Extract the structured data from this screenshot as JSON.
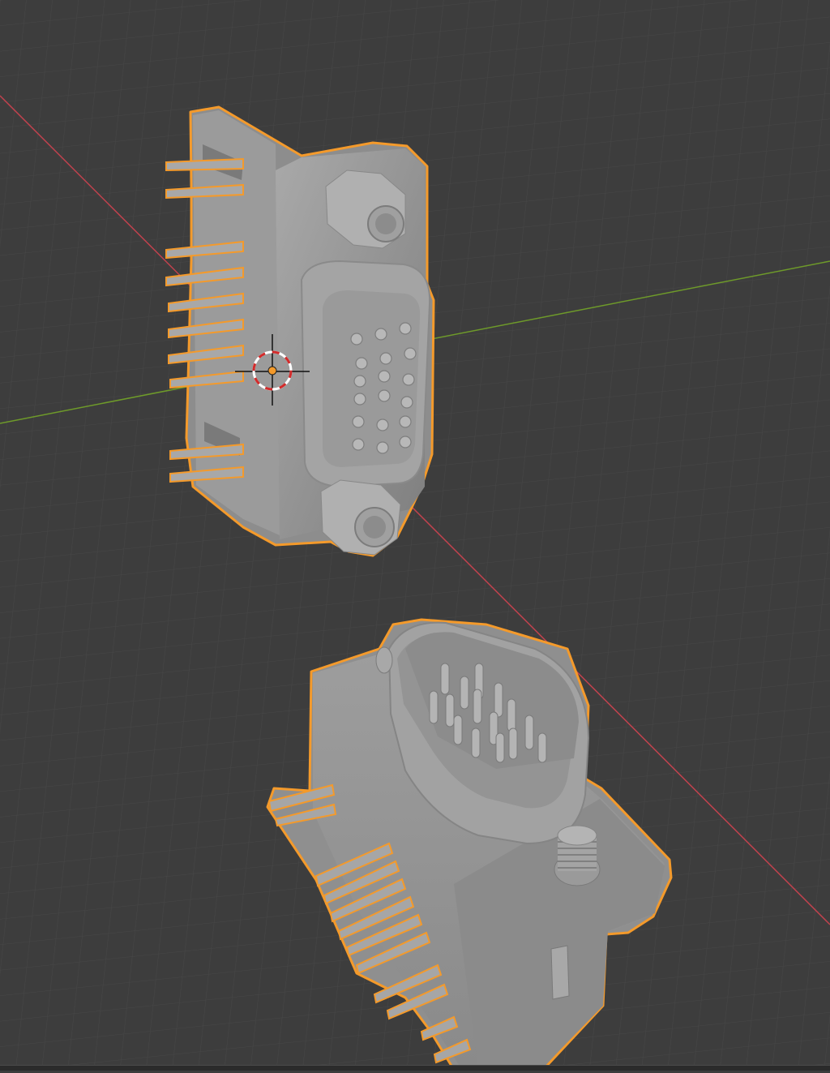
{
  "viewport": {
    "mode": "solid",
    "background": "#3d3d3d",
    "grid_minor_color": "#474747",
    "grid_major_color": "#4f4f4f",
    "x_axis_color": "#c2424e",
    "y_axis_color": "#6e9a2a",
    "selection_outline_color": "#f49a2b",
    "mesh_color": "#9a9a9a",
    "objects": [
      {
        "name": "vga-female-connector",
        "selected": true,
        "pins_visible": 15
      },
      {
        "name": "vga-male-connector",
        "selected": true,
        "pins_visible": 15
      }
    ],
    "cursor": "3d-cursor-icon"
  }
}
